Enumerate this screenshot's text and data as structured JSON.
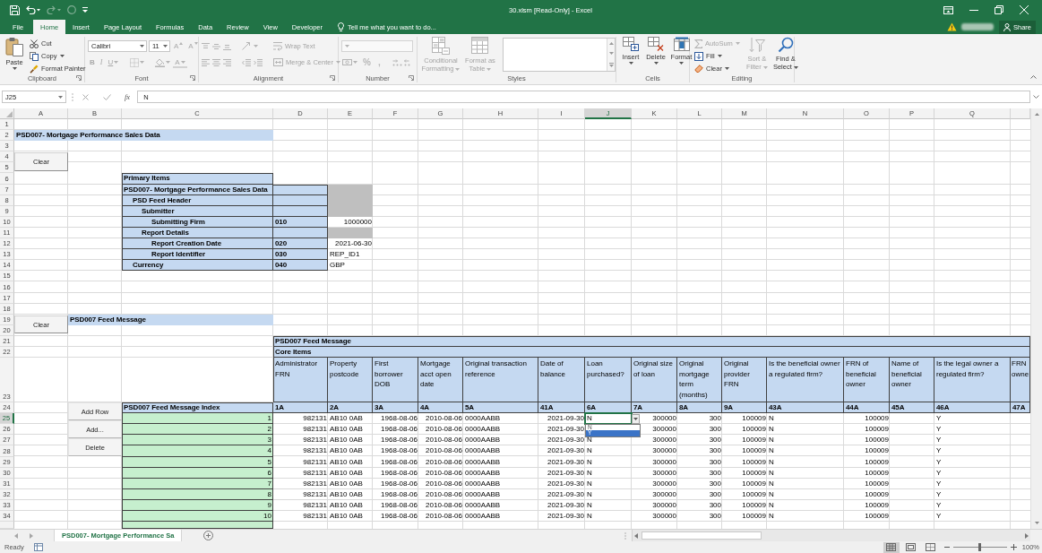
{
  "window": {
    "title": "30.xlsm [Read-Only] - Excel"
  },
  "ribbon_tabs": [
    {
      "label": "File",
      "selected": false
    },
    {
      "label": "Home",
      "selected": true
    },
    {
      "label": "Insert",
      "selected": false
    },
    {
      "label": "Page Layout",
      "selected": false
    },
    {
      "label": "Formulas",
      "selected": false
    },
    {
      "label": "Data",
      "selected": false
    },
    {
      "label": "Review",
      "selected": false
    },
    {
      "label": "View",
      "selected": false
    },
    {
      "label": "Developer",
      "selected": false
    }
  ],
  "tell_me": {
    "placeholder": "Tell me what you want to do..."
  },
  "share_button": {
    "label": "Share"
  },
  "ribbon_groups": [
    {
      "kind": "clipboard",
      "label": "Clipboard",
      "commands": [
        {
          "label": "Paste",
          "kind": "large",
          "disabled": false
        },
        {
          "label": "Cut",
          "kind": "small",
          "disabled": false
        },
        {
          "label": "Copy",
          "kind": "small",
          "disabled": false
        },
        {
          "label": "Format Painter",
          "kind": "small",
          "disabled": false
        }
      ]
    },
    {
      "kind": "font",
      "label": "Font",
      "disabled": true,
      "font_name": "Calibri",
      "font_size": "11",
      "commands": [
        {
          "label": "A",
          "kind": "grow",
          "disabled": true
        },
        {
          "label": "A",
          "kind": "shrink",
          "disabled": true
        },
        {
          "label": "B",
          "kind": "bold",
          "disabled": true
        },
        {
          "label": "I",
          "kind": "italic",
          "disabled": true
        },
        {
          "label": "U",
          "kind": "underline",
          "disabled": true
        },
        {
          "label": "A",
          "kind": "color",
          "disabled": true
        }
      ]
    },
    {
      "kind": "alignment",
      "label": "Alignment",
      "disabled": true,
      "commands": [
        {
          "label": "Wrap Text",
          "disabled": true
        },
        {
          "label": "Merge & Center",
          "disabled": true
        }
      ]
    },
    {
      "kind": "number",
      "label": "Number",
      "disabled": true,
      "commands": [
        {
          "label": "%",
          "disabled": true
        },
        {
          "label": ",",
          "disabled": true
        }
      ]
    },
    {
      "kind": "styles",
      "label": "Styles",
      "commands": [
        {
          "label": "Conditional Formatting",
          "kind": "large",
          "disabled": true
        },
        {
          "label": "Format as Table",
          "kind": "large",
          "disabled": true
        }
      ]
    },
    {
      "kind": "cells",
      "label": "Cells",
      "commands": [
        {
          "label": "Insert",
          "kind": "large",
          "disabled": false
        },
        {
          "label": "Delete",
          "kind": "large",
          "disabled": false
        },
        {
          "label": "Format",
          "kind": "large",
          "disabled": false
        }
      ]
    },
    {
      "kind": "editing",
      "label": "Editing",
      "commands": [
        {
          "label": "AutoSum",
          "kind": "small",
          "disabled": true
        },
        {
          "label": "Fill",
          "kind": "small",
          "disabled": false
        },
        {
          "label": "Clear",
          "kind": "small",
          "disabled": false
        },
        {
          "label": "Sort & Filter",
          "kind": "large",
          "disabled": true
        },
        {
          "label": "Find & Select",
          "kind": "large",
          "disabled": false
        }
      ]
    }
  ],
  "formula_bar": {
    "name_box": "J25",
    "function_label": "fx",
    "value": "N"
  },
  "sheet": {
    "column_letters": [
      {
        "label": "A",
        "selected": false
      },
      {
        "label": "B",
        "selected": false
      },
      {
        "label": "C",
        "selected": false
      },
      {
        "label": "D",
        "selected": false
      },
      {
        "label": "E",
        "selected": false
      },
      {
        "label": "F",
        "selected": false
      },
      {
        "label": "G",
        "selected": false
      },
      {
        "label": "H",
        "selected": false
      },
      {
        "label": "I",
        "selected": false
      },
      {
        "label": "J",
        "selected": true
      },
      {
        "label": "K",
        "selected": false
      },
      {
        "label": "L",
        "selected": false
      },
      {
        "label": "M",
        "selected": false
      },
      {
        "label": "N",
        "selected": false
      },
      {
        "label": "O",
        "selected": false
      },
      {
        "label": "P",
        "selected": false
      },
      {
        "label": "Q",
        "selected": false
      }
    ],
    "row_numbers": [
      {
        "label": "1",
        "selected": false
      },
      {
        "label": "2",
        "selected": false
      },
      {
        "label": "3",
        "selected": false
      },
      {
        "label": "4",
        "selected": false
      },
      {
        "label": "5",
        "selected": false
      },
      {
        "label": "6",
        "selected": false
      },
      {
        "label": "7",
        "selected": false
      },
      {
        "label": "8",
        "selected": false
      },
      {
        "label": "9",
        "selected": false
      },
      {
        "label": "10",
        "selected": false
      },
      {
        "label": "11",
        "selected": false
      },
      {
        "label": "12",
        "selected": false
      },
      {
        "label": "13",
        "selected": false
      },
      {
        "label": "14",
        "selected": false
      },
      {
        "label": "15",
        "selected": false
      },
      {
        "label": "16",
        "selected": false
      },
      {
        "label": "17",
        "selected": false
      },
      {
        "label": "18",
        "selected": false
      },
      {
        "label": "19",
        "selected": false
      },
      {
        "label": "20",
        "selected": false
      },
      {
        "label": "21",
        "selected": false
      },
      {
        "label": "22",
        "selected": false
      },
      {
        "label": "23",
        "selected": false
      },
      {
        "label": "24",
        "selected": false
      },
      {
        "label": "25",
        "selected": true
      },
      {
        "label": "26",
        "selected": false
      },
      {
        "label": "27",
        "selected": false
      },
      {
        "label": "28",
        "selected": false
      },
      {
        "label": "29",
        "selected": false
      },
      {
        "label": "30",
        "selected": false
      },
      {
        "label": "31",
        "selected": false
      },
      {
        "label": "32",
        "selected": false
      },
      {
        "label": "33",
        "selected": false
      },
      {
        "label": "34",
        "selected": false
      }
    ],
    "title": "PSD007- Mortgage Performance Sales Data",
    "clear_buttons": [
      {
        "label": "Clear"
      },
      {
        "label": "Clear"
      }
    ],
    "primary_items": {
      "title": "Primary Items",
      "items": [
        {
          "label": "PSD007- Mortgage Performance Sales Data",
          "kind": "group",
          "children": [
            {
              "label": "PSD Feed Header",
              "kind": "group",
              "children": [
                {
                  "label": "Submitter",
                  "kind": "group",
                  "children": [
                    {
                      "label": "Submitting Firm",
                      "kind": "number",
                      "code": "010",
                      "value": "1000000"
                    }
                  ]
                },
                {
                  "label": "Report Details",
                  "kind": "group",
                  "children": [
                    {
                      "label": "Report Creation Date",
                      "kind": "number",
                      "code": "020",
                      "value": "2021-06-30"
                    },
                    {
                      "label": "Report Identifier",
                      "kind": "text",
                      "code": "030",
                      "value": "REP_ID1"
                    }
                  ]
                }
              ]
            },
            {
              "label": "Currency",
              "kind": "text",
              "code": "040",
              "value": "GBP"
            }
          ]
        }
      ]
    },
    "feed_message": {
      "label": "PSD007 Feed Message",
      "table_title": "PSD007 Feed Message",
      "section": "Core Items",
      "index_header": "PSD007 Feed Message Index",
      "row_buttons": [
        {
          "label": "Add Row"
        },
        {
          "label": "Add..."
        },
        {
          "label": "Delete"
        }
      ],
      "index": [
        "1",
        "2",
        "3",
        "4",
        "5",
        "6",
        "7",
        "8",
        "9",
        "10"
      ],
      "columns": [
        {
          "label": "Administrator FRN",
          "code": "1A",
          "kind": "number",
          "values": [
            "982131",
            "982131",
            "982131",
            "982131",
            "982131",
            "982131",
            "982131",
            "982131",
            "982131",
            "982131"
          ]
        },
        {
          "label": "Property postcode",
          "code": "2A",
          "kind": "text",
          "values": [
            "AB10 0AB",
            "AB10 0AB",
            "AB10 0AB",
            "AB10 0AB",
            "AB10 0AB",
            "AB10 0AB",
            "AB10 0AB",
            "AB10 0AB",
            "AB10 0AB",
            "AB10 0AB"
          ]
        },
        {
          "label": "First borrower DOB",
          "code": "3A",
          "kind": "number",
          "values": [
            "1968-08-06",
            "1968-08-06",
            "1968-08-06",
            "1968-08-06",
            "1968-08-06",
            "1968-08-06",
            "1968-08-06",
            "1968-08-06",
            "1968-08-06",
            "1968-08-06"
          ]
        },
        {
          "label": "Mortgage acct open date",
          "code": "4A",
          "kind": "number",
          "values": [
            "2010-08-06",
            "2010-08-06",
            "2010-08-06",
            "2010-08-06",
            "2010-08-06",
            "2010-08-06",
            "2010-08-06",
            "2010-08-06",
            "2010-08-06",
            "2010-08-06"
          ]
        },
        {
          "label": "Original transaction reference",
          "code": "5A",
          "kind": "text",
          "values": [
            "0000AABB",
            "0000AABB",
            "0000AABB",
            "0000AABB",
            "0000AABB",
            "0000AABB",
            "0000AABB",
            "0000AABB",
            "0000AABB",
            "0000AABB"
          ]
        },
        {
          "label": "Date of balance",
          "code": "41A",
          "kind": "number",
          "values": [
            "2021-09-30",
            "2021-09-30",
            "2021-09-30",
            "2021-09-30",
            "2021-09-30",
            "2021-09-30",
            "2021-09-30",
            "2021-09-30",
            "2021-09-30",
            "2021-09-30"
          ]
        },
        {
          "label": "Loan purchased?",
          "code": "6A",
          "kind": "text",
          "values": [
            "N",
            "N",
            "N",
            "N",
            "N",
            "N",
            "N",
            "N",
            "N"
          ]
        },
        {
          "label": "Original size of loan",
          "code": "7A",
          "kind": "number",
          "values": [
            "300000",
            "300000",
            "300000",
            "300000",
            "300000",
            "300000",
            "300000",
            "300000",
            "300000",
            "300000"
          ]
        },
        {
          "label": "Original mortgage term (months)",
          "code": "8A",
          "kind": "number",
          "values": [
            "300",
            "300",
            "300",
            "300",
            "300",
            "300",
            "300",
            "300",
            "300",
            "300"
          ]
        },
        {
          "label": "Original provider FRN",
          "code": "9A",
          "kind": "number",
          "values": [
            "100009",
            "100009",
            "100009",
            "100009",
            "100009",
            "100009",
            "100009",
            "100009",
            "100009",
            "100009"
          ]
        },
        {
          "label": "Is the beneficial owner a regulated firm?",
          "code": "43A",
          "kind": "text",
          "values": [
            "N",
            "N",
            "N",
            "N",
            "N",
            "N",
            "N",
            "N",
            "N",
            "N"
          ]
        },
        {
          "label": "FRN of beneficial owner",
          "code": "44A",
          "kind": "number",
          "values": [
            "100009",
            "100009",
            "100009",
            "100009",
            "100009",
            "100009",
            "100009",
            "100009",
            "100009",
            "100009"
          ]
        },
        {
          "label": "Name of beneficial owner",
          "code": "45A"
        },
        {
          "label": "Is the legal owner a regulated firm?",
          "code": "46A",
          "kind": "text",
          "values": [
            "Y",
            "Y",
            "Y",
            "Y",
            "Y",
            "Y",
            "Y",
            "Y",
            "Y",
            "Y"
          ]
        },
        {
          "label": "FRN owne",
          "code": "47A"
        }
      ]
    },
    "validation_list": [
      {
        "label": "N",
        "selected": false
      },
      {
        "label": "Y",
        "selected": true
      }
    ]
  },
  "sheet_tabs": [
    {
      "label": "PSD007- Mortgage Performance Sa",
      "selected": true
    }
  ],
  "status_bar": {
    "status": "Ready",
    "views": [
      {
        "selected": true
      },
      {
        "selected": false
      },
      {
        "selected": false
      }
    ],
    "zoom": {
      "level": 0.5,
      "reading": "100%"
    }
  }
}
